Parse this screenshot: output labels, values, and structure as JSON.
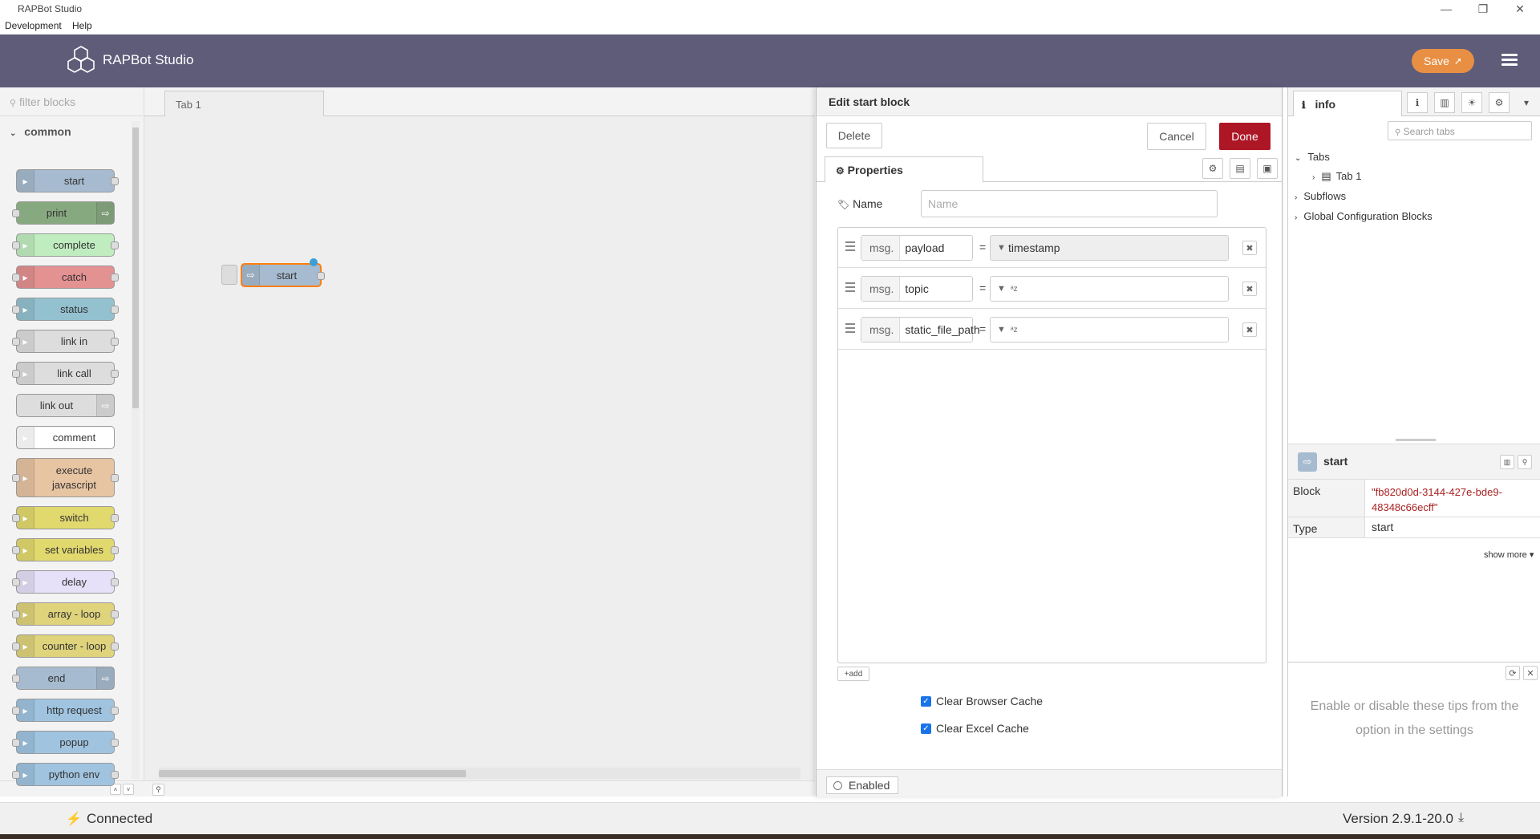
{
  "window": {
    "title": "RAPBot Studio",
    "min": "—",
    "max": "❐",
    "close": "✕"
  },
  "menu": [
    "Development",
    "Help"
  ],
  "header": {
    "title": "RAPBot Studio",
    "save_label": "Save"
  },
  "palette": {
    "filter_placeholder": "filter blocks",
    "category": "common",
    "nodes": [
      {
        "label": "start",
        "color": "#a6bbcf"
      },
      {
        "label": "print",
        "color": "#87a980"
      },
      {
        "label": "complete",
        "color": "#c0edc0"
      },
      {
        "label": "catch",
        "color": "#e49191"
      },
      {
        "label": "status",
        "color": "#94c1d0"
      },
      {
        "label": "link in",
        "color": "#dddddd"
      },
      {
        "label": "link call",
        "color": "#dddddd"
      },
      {
        "label": "link out",
        "color": "#dddddd"
      },
      {
        "label": "comment",
        "color": "#ffffff"
      },
      {
        "label": "execute javascript",
        "color": "#e7c4a2"
      },
      {
        "label": "switch",
        "color": "#e2d96e"
      },
      {
        "label": "set variables",
        "color": "#e2d96e"
      },
      {
        "label": "delay",
        "color": "#e6e0f8"
      },
      {
        "label": "array - loop",
        "color": "#dfd37c"
      },
      {
        "label": "counter - loop",
        "color": "#dfd37c"
      },
      {
        "label": "end",
        "color": "#a6bbcf"
      },
      {
        "label": "http request",
        "color": "#a0c4e0"
      },
      {
        "label": "popup",
        "color": "#a0c4e0"
      },
      {
        "label": "python env",
        "color": "#a0c4e0"
      }
    ]
  },
  "workspace": {
    "tab": "Tab 1",
    "node_label": "start"
  },
  "editor": {
    "title": "Edit start block",
    "delete": "Delete",
    "cancel": "Cancel",
    "done": "Done",
    "properties_tab": "Properties",
    "name_label": "Name",
    "name_placeholder": "Name",
    "rules": [
      {
        "prefix": "msg.",
        "property": "payload",
        "eq": "=",
        "value": "timestamp"
      },
      {
        "prefix": "msg.",
        "property": "topic",
        "eq": "=",
        "value": ""
      },
      {
        "prefix": "msg.",
        "property": "static_file_path",
        "eq": "=",
        "value": ""
      }
    ],
    "add_label": "add",
    "clear_browser_cache": "Clear Browser Cache",
    "clear_excel_cache": "Clear Excel Cache",
    "enabled": "Enabled"
  },
  "sidebar": {
    "tab_label": "info",
    "search_placeholder": "Search tabs",
    "tree": {
      "tabs": "Tabs",
      "tab1": "Tab 1",
      "subflows": "Subflows",
      "global": "Global Configuration Blocks"
    },
    "node_name": "start",
    "block_label": "Block",
    "block_value": "\"fb820d0d-3144-427e-bde9-48348c66ecff\"",
    "type_label": "Type",
    "type_value": "start",
    "show_more": "show more",
    "tips": "Enable or disable these tips from the option in the settings"
  },
  "status": {
    "connected": "Connected",
    "version": "Version 2.9.1-20.0"
  },
  "colors": {
    "header": "#5f5c7a",
    "save": "#e88f43",
    "done": "#ad1625",
    "block_value": "#aa2222"
  }
}
